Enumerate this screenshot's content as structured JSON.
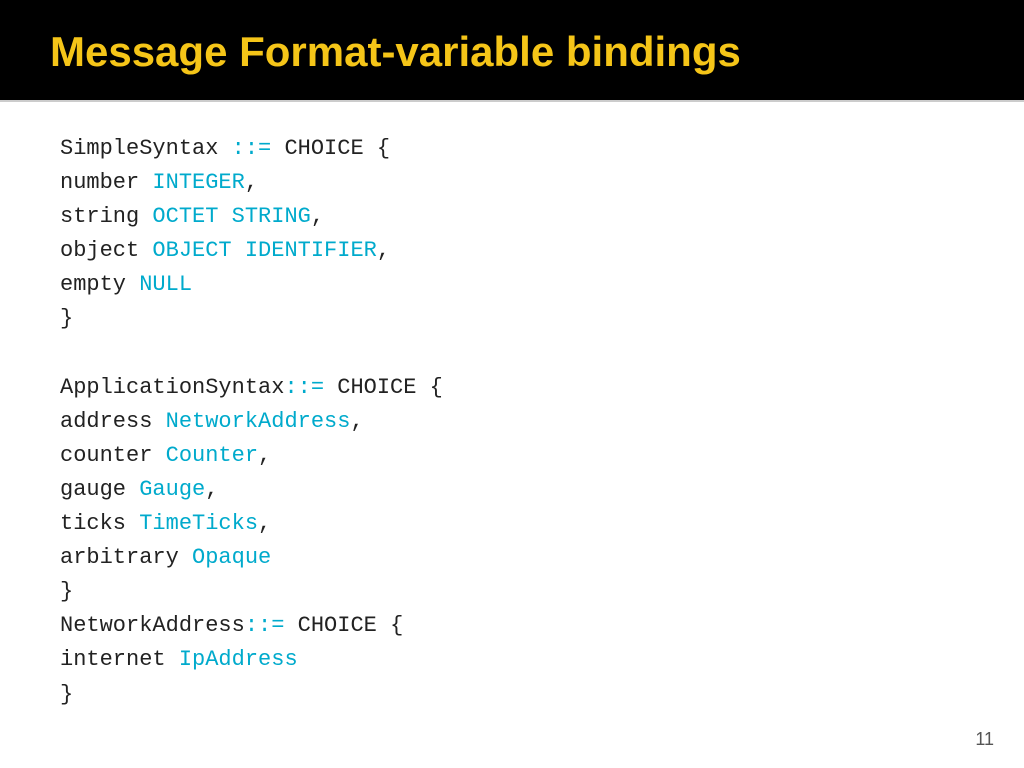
{
  "header": {
    "title": "Message Format-variable bindings"
  },
  "slide_number": "11",
  "code": {
    "lines": [
      {
        "text": "SimpleSyntax ::= CHOICE {",
        "parts": [
          {
            "t": "SimpleSyntax ",
            "c": "black"
          },
          {
            "t": "::=",
            "c": "cyan"
          },
          {
            "t": " CHOICE {",
            "c": "black"
          }
        ]
      },
      {
        "text": "    number INTEGER,",
        "parts": [
          {
            "t": "    number ",
            "c": "black"
          },
          {
            "t": "INTEGER",
            "c": "cyan"
          },
          {
            "t": ",",
            "c": "black"
          }
        ]
      },
      {
        "text": "    string OCTET STRING,",
        "parts": [
          {
            "t": "    string ",
            "c": "black"
          },
          {
            "t": "OCTET STRING",
            "c": "cyan"
          },
          {
            "t": ",",
            "c": "black"
          }
        ]
      },
      {
        "text": "    object OBJECT IDENTIFIER,",
        "parts": [
          {
            "t": "    object ",
            "c": "black"
          },
          {
            "t": "OBJECT IDENTIFIER",
            "c": "cyan"
          },
          {
            "t": ",",
            "c": "black"
          }
        ]
      },
      {
        "text": "    empty  NULL",
        "parts": [
          {
            "t": "    empty  ",
            "c": "black"
          },
          {
            "t": "NULL",
            "c": "cyan"
          }
        ]
      },
      {
        "text": "}",
        "parts": [
          {
            "t": "}",
            "c": "black"
          }
        ]
      },
      {
        "text": "",
        "parts": []
      },
      {
        "text": "ApplicationSyntax::= CHOICE {",
        "parts": [
          {
            "t": "ApplicationSyntax",
            "c": "black"
          },
          {
            "t": "::=",
            "c": "cyan"
          },
          {
            "t": " CHOICE {",
            "c": "black"
          }
        ]
      },
      {
        "text": "    address    NetworkAddress,",
        "parts": [
          {
            "t": "    address    ",
            "c": "black"
          },
          {
            "t": "NetworkAddress",
            "c": "cyan"
          },
          {
            "t": ",",
            "c": "black"
          }
        ]
      },
      {
        "text": "    counter    Counter,",
        "parts": [
          {
            "t": "    counter    ",
            "c": "black"
          },
          {
            "t": "Counter",
            "c": "cyan"
          },
          {
            "t": ",",
            "c": "black"
          }
        ]
      },
      {
        "text": "    gauge      Gauge,",
        "parts": [
          {
            "t": "    gauge      ",
            "c": "black"
          },
          {
            "t": "Gauge",
            "c": "cyan"
          },
          {
            "t": ",",
            "c": "black"
          }
        ]
      },
      {
        "text": "    ticks      TimeTicks,",
        "parts": [
          {
            "t": "    ticks      ",
            "c": "black"
          },
          {
            "t": "TimeTicks",
            "c": "cyan"
          },
          {
            "t": ",",
            "c": "black"
          }
        ]
      },
      {
        "text": "    arbitrary  Opaque",
        "parts": [
          {
            "t": "    arbitrary  ",
            "c": "black"
          },
          {
            "t": "Opaque",
            "c": "cyan"
          }
        ]
      },
      {
        "text": "}",
        "parts": [
          {
            "t": "}",
            "c": "black"
          }
        ]
      },
      {
        "text": "NetworkAddress::= CHOICE {",
        "parts": [
          {
            "t": "NetworkAddress",
            "c": "black"
          },
          {
            "t": "::=",
            "c": "cyan"
          },
          {
            "t": " CHOICE {",
            "c": "black"
          }
        ]
      },
      {
        "text": "    internet  IpAddress",
        "parts": [
          {
            "t": "    internet  ",
            "c": "black"
          },
          {
            "t": "IpAddress",
            "c": "cyan"
          }
        ]
      },
      {
        "text": "}",
        "parts": [
          {
            "t": "}",
            "c": "black"
          }
        ]
      }
    ]
  }
}
